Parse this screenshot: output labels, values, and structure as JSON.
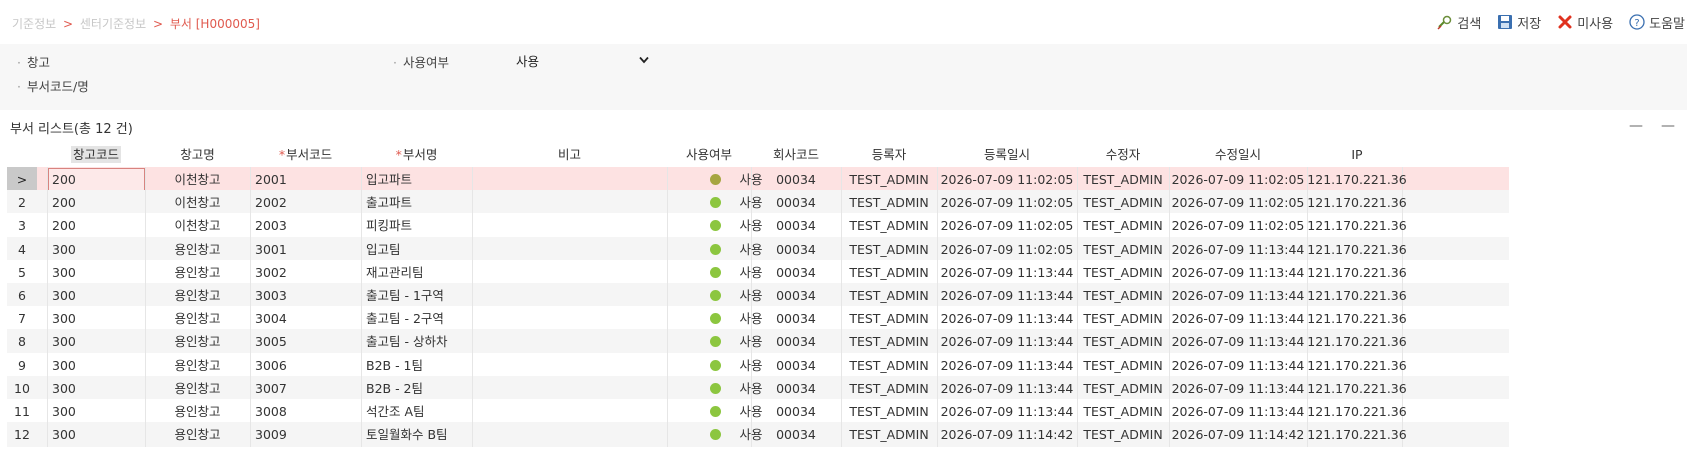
{
  "breadcrumb": {
    "parent1": "기준정보",
    "sep1": ">",
    "parent2": "센터기준정보",
    "sep2": ">",
    "current": "부서 [H000005]"
  },
  "actions": {
    "search": "검색",
    "save": "저장",
    "unused": "미사용",
    "help": "도움말"
  },
  "filters": {
    "warehouse_label": "창고",
    "dept_label": "부서코드/명",
    "use_label": "사용여부",
    "use_selected": "사용"
  },
  "list": {
    "title": "부서 리스트(총 12 건)",
    "tool1": "—",
    "tool2": "—"
  },
  "columns": [
    {
      "label": "창고코드",
      "required": false
    },
    {
      "label": "창고명",
      "required": false
    },
    {
      "label": "부서코드",
      "required": true
    },
    {
      "label": "부서명",
      "required": true
    },
    {
      "label": "비고",
      "required": false
    },
    {
      "label": "사용여부",
      "required": false
    },
    {
      "label": "회사코드",
      "required": false
    },
    {
      "label": "등록자",
      "required": false
    },
    {
      "label": "등록일시",
      "required": false
    },
    {
      "label": "수정자",
      "required": false
    },
    {
      "label": "수정일시",
      "required": false
    },
    {
      "label": "IP",
      "required": false
    }
  ],
  "rows": [
    {
      "num": ">",
      "wh_code": "200",
      "wh_name": "이천창고",
      "dept_code": "2001",
      "dept_name": "입고파트",
      "note": "",
      "use": "사용",
      "company": "00034",
      "reg_user": "TEST_ADMIN",
      "reg_date": "2026-07-09 11:02:05",
      "mod_user": "TEST_ADMIN",
      "mod_date": "2026-07-09 11:02:05",
      "ip": "121.170.221.36"
    },
    {
      "num": "2",
      "wh_code": "200",
      "wh_name": "이천창고",
      "dept_code": "2002",
      "dept_name": "출고파트",
      "note": "",
      "use": "사용",
      "company": "00034",
      "reg_user": "TEST_ADMIN",
      "reg_date": "2026-07-09 11:02:05",
      "mod_user": "TEST_ADMIN",
      "mod_date": "2026-07-09 11:02:05",
      "ip": "121.170.221.36"
    },
    {
      "num": "3",
      "wh_code": "200",
      "wh_name": "이천창고",
      "dept_code": "2003",
      "dept_name": "피킹파트",
      "note": "",
      "use": "사용",
      "company": "00034",
      "reg_user": "TEST_ADMIN",
      "reg_date": "2026-07-09 11:02:05",
      "mod_user": "TEST_ADMIN",
      "mod_date": "2026-07-09 11:02:05",
      "ip": "121.170.221.36"
    },
    {
      "num": "4",
      "wh_code": "300",
      "wh_name": "용인창고",
      "dept_code": "3001",
      "dept_name": "입고팀",
      "note": "",
      "use": "사용",
      "company": "00034",
      "reg_user": "TEST_ADMIN",
      "reg_date": "2026-07-09 11:02:05",
      "mod_user": "TEST_ADMIN",
      "mod_date": "2026-07-09 11:13:44",
      "ip": "121.170.221.36"
    },
    {
      "num": "5",
      "wh_code": "300",
      "wh_name": "용인창고",
      "dept_code": "3002",
      "dept_name": "재고관리팀",
      "note": "",
      "use": "사용",
      "company": "00034",
      "reg_user": "TEST_ADMIN",
      "reg_date": "2026-07-09 11:13:44",
      "mod_user": "TEST_ADMIN",
      "mod_date": "2026-07-09 11:13:44",
      "ip": "121.170.221.36"
    },
    {
      "num": "6",
      "wh_code": "300",
      "wh_name": "용인창고",
      "dept_code": "3003",
      "dept_name": "출고팀 - 1구역",
      "note": "",
      "use": "사용",
      "company": "00034",
      "reg_user": "TEST_ADMIN",
      "reg_date": "2026-07-09 11:13:44",
      "mod_user": "TEST_ADMIN",
      "mod_date": "2026-07-09 11:13:44",
      "ip": "121.170.221.36"
    },
    {
      "num": "7",
      "wh_code": "300",
      "wh_name": "용인창고",
      "dept_code": "3004",
      "dept_name": "출고팀 - 2구역",
      "note": "",
      "use": "사용",
      "company": "00034",
      "reg_user": "TEST_ADMIN",
      "reg_date": "2026-07-09 11:13:44",
      "mod_user": "TEST_ADMIN",
      "mod_date": "2026-07-09 11:13:44",
      "ip": "121.170.221.36"
    },
    {
      "num": "8",
      "wh_code": "300",
      "wh_name": "용인창고",
      "dept_code": "3005",
      "dept_name": "출고팀 - 상하차",
      "note": "",
      "use": "사용",
      "company": "00034",
      "reg_user": "TEST_ADMIN",
      "reg_date": "2026-07-09 11:13:44",
      "mod_user": "TEST_ADMIN",
      "mod_date": "2026-07-09 11:13:44",
      "ip": "121.170.221.36"
    },
    {
      "num": "9",
      "wh_code": "300",
      "wh_name": "용인창고",
      "dept_code": "3006",
      "dept_name": "B2B - 1팀",
      "note": "",
      "use": "사용",
      "company": "00034",
      "reg_user": "TEST_ADMIN",
      "reg_date": "2026-07-09 11:13:44",
      "mod_user": "TEST_ADMIN",
      "mod_date": "2026-07-09 11:13:44",
      "ip": "121.170.221.36"
    },
    {
      "num": "10",
      "wh_code": "300",
      "wh_name": "용인창고",
      "dept_code": "3007",
      "dept_name": "B2B - 2팀",
      "note": "",
      "use": "사용",
      "company": "00034",
      "reg_user": "TEST_ADMIN",
      "reg_date": "2026-07-09 11:13:44",
      "mod_user": "TEST_ADMIN",
      "mod_date": "2026-07-09 11:13:44",
      "ip": "121.170.221.36"
    },
    {
      "num": "11",
      "wh_code": "300",
      "wh_name": "용인창고",
      "dept_code": "3008",
      "dept_name": "석간조 A팀",
      "note": "",
      "use": "사용",
      "company": "00034",
      "reg_user": "TEST_ADMIN",
      "reg_date": "2026-07-09 11:13:44",
      "mod_user": "TEST_ADMIN",
      "mod_date": "2026-07-09 11:13:44",
      "ip": "121.170.221.36"
    },
    {
      "num": "12",
      "wh_code": "300",
      "wh_name": "용인창고",
      "dept_code": "3009",
      "dept_name": "토일월화수 B팀",
      "note": "",
      "use": "사용",
      "company": "00034",
      "reg_user": "TEST_ADMIN",
      "reg_date": "2026-07-09 11:14:42",
      "mod_user": "TEST_ADMIN",
      "mod_date": "2026-07-09 11:14:42",
      "ip": "121.170.221.36"
    }
  ],
  "selected_row": 0,
  "colors": {
    "accent": "#e05a4f",
    "selected_row_bg": "#fde2e2",
    "status_green": "#8cc63f",
    "status_olive": "#a6a540"
  }
}
